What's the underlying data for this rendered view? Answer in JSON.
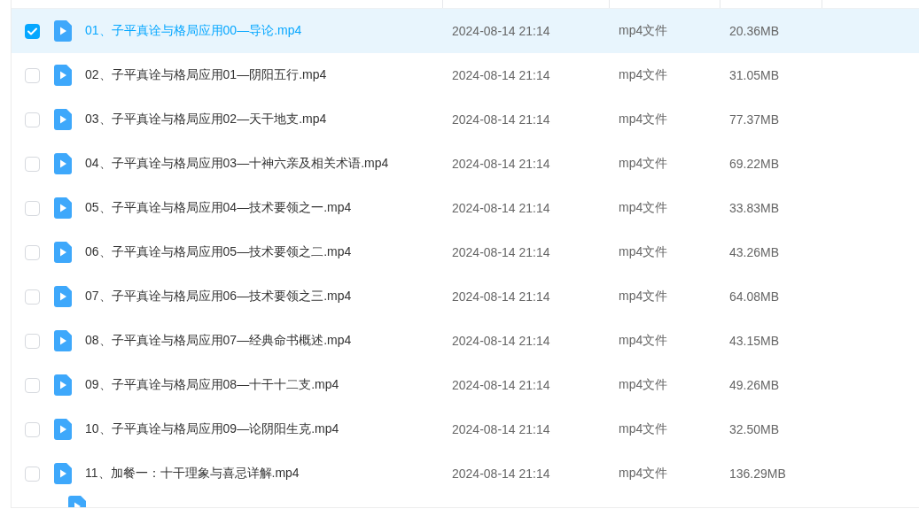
{
  "files": [
    {
      "name": "01、子平真诠与格局应用00—导论.mp4",
      "modified": "2024-08-14 21:14",
      "type": "mp4文件",
      "size": "20.36MB",
      "selected": true
    },
    {
      "name": "02、子平真诠与格局应用01—阴阳五行.mp4",
      "modified": "2024-08-14 21:14",
      "type": "mp4文件",
      "size": "31.05MB",
      "selected": false
    },
    {
      "name": "03、子平真诠与格局应用02—天干地支.mp4",
      "modified": "2024-08-14 21:14",
      "type": "mp4文件",
      "size": "77.37MB",
      "selected": false
    },
    {
      "name": "04、子平真诠与格局应用03—十神六亲及相关术语.mp4",
      "modified": "2024-08-14 21:14",
      "type": "mp4文件",
      "size": "69.22MB",
      "selected": false
    },
    {
      "name": "05、子平真诠与格局应用04—技术要领之一.mp4",
      "modified": "2024-08-14 21:14",
      "type": "mp4文件",
      "size": "33.83MB",
      "selected": false
    },
    {
      "name": "06、子平真诠与格局应用05—技术要领之二.mp4",
      "modified": "2024-08-14 21:14",
      "type": "mp4文件",
      "size": "43.26MB",
      "selected": false
    },
    {
      "name": "07、子平真诠与格局应用06—技术要领之三.mp4",
      "modified": "2024-08-14 21:14",
      "type": "mp4文件",
      "size": "64.08MB",
      "selected": false
    },
    {
      "name": "08、子平真诠与格局应用07—经典命书概述.mp4",
      "modified": "2024-08-14 21:14",
      "type": "mp4文件",
      "size": "43.15MB",
      "selected": false
    },
    {
      "name": "09、子平真诠与格局应用08—十干十二支.mp4",
      "modified": "2024-08-14 21:14",
      "type": "mp4文件",
      "size": "49.26MB",
      "selected": false
    },
    {
      "name": "10、子平真诠与格局应用09—论阴阳生克.mp4",
      "modified": "2024-08-14 21:14",
      "type": "mp4文件",
      "size": "32.50MB",
      "selected": false
    },
    {
      "name": "11、加餐一：十干理象与喜忌详解.mp4",
      "modified": "2024-08-14 21:14",
      "type": "mp4文件",
      "size": "136.29MB",
      "selected": false
    }
  ]
}
